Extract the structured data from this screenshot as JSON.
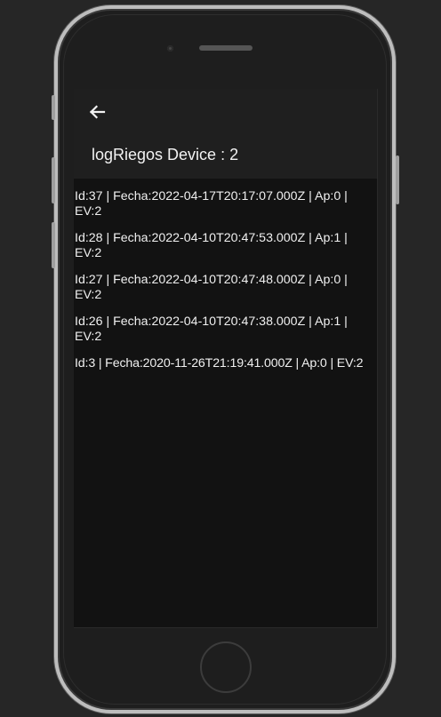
{
  "header": {
    "back_icon": "arrow-left-icon",
    "title": "logRiegos Device : 2"
  },
  "logs": [
    {
      "text": "Id:37 | Fecha:2022-04-17T20:17:07.000Z | Ap:0 | EV:2"
    },
    {
      "text": "Id:28 | Fecha:2022-04-10T20:47:53.000Z | Ap:1 | EV:2"
    },
    {
      "text": "Id:27 | Fecha:2022-04-10T20:47:48.000Z | Ap:0 | EV:2"
    },
    {
      "text": "Id:26 | Fecha:2022-04-10T20:47:38.000Z | Ap:1 | EV:2"
    },
    {
      "text": "Id:3 | Fecha:2020-11-26T21:19:41.000Z | Ap:0 | EV:2"
    }
  ],
  "colors": {
    "background": "#262626",
    "screen": "#121212",
    "toolbar": "#1f1f1f",
    "text": "#f0f0f0"
  }
}
